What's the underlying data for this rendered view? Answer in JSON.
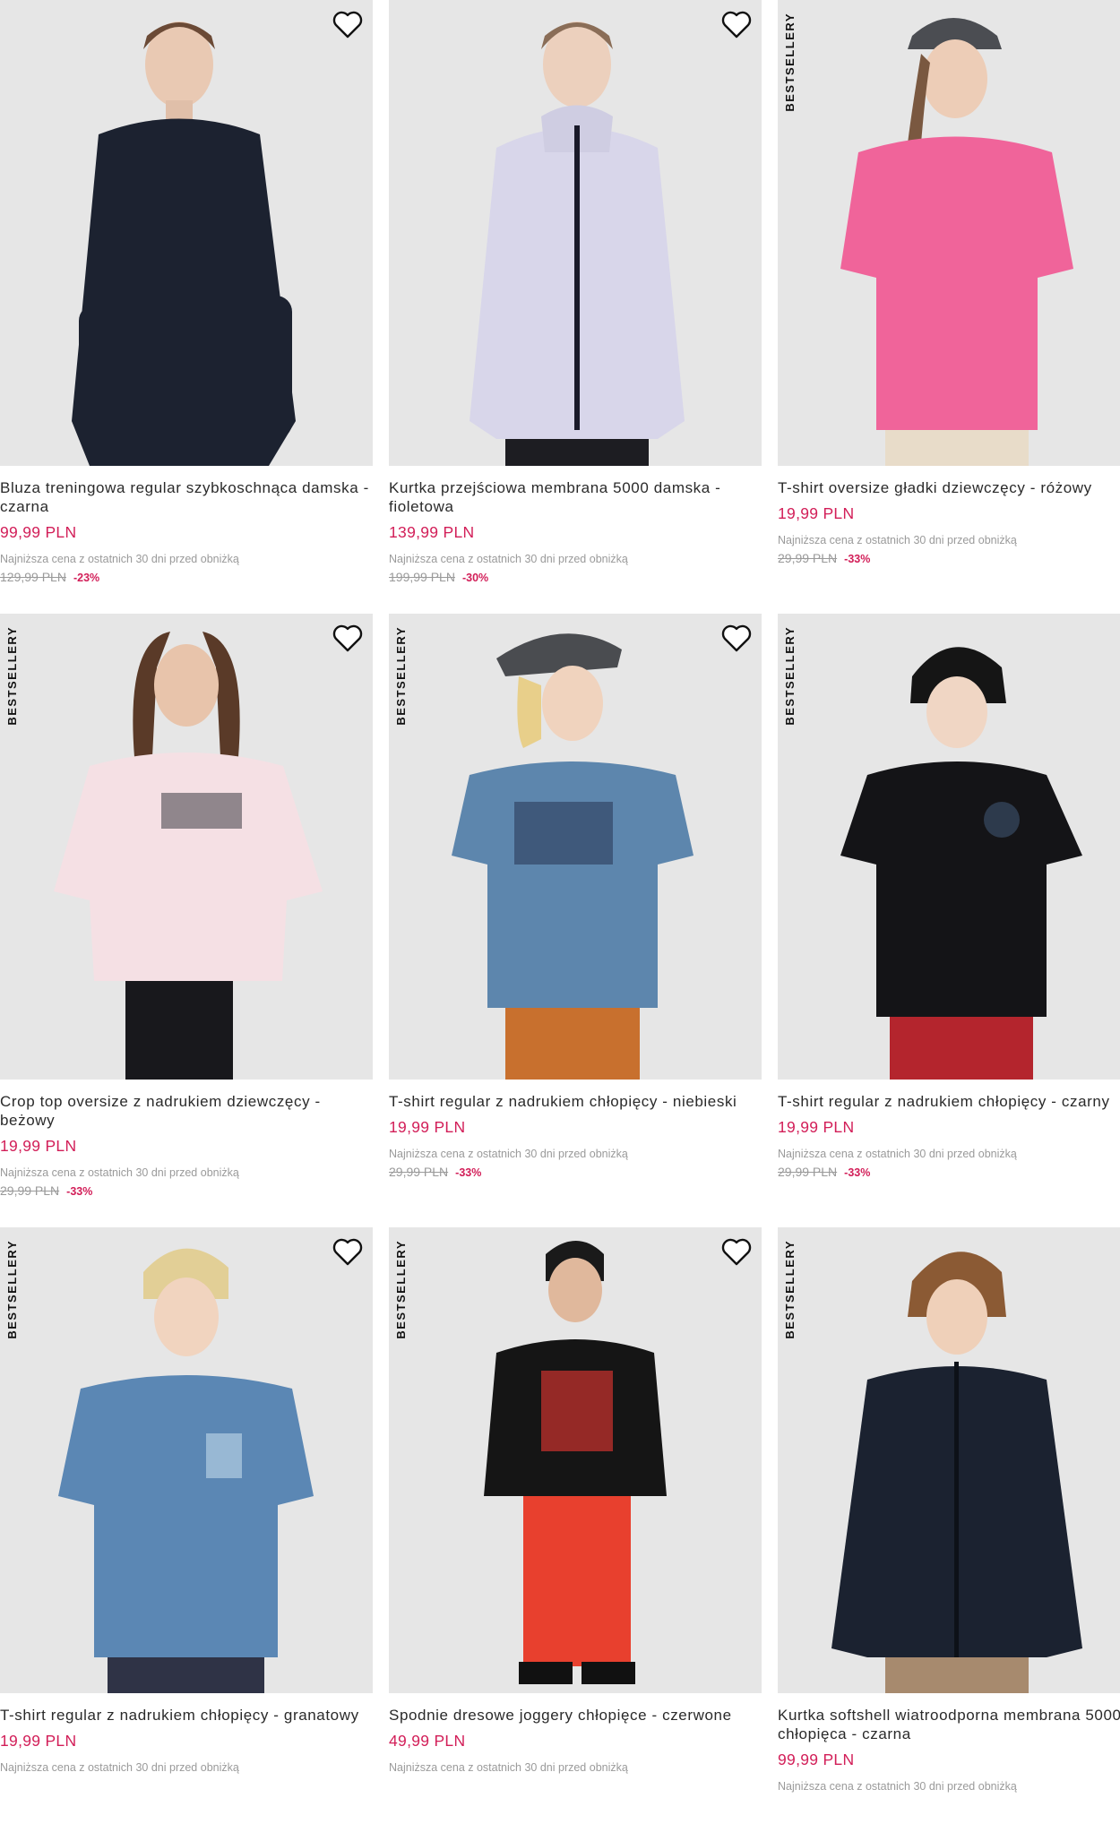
{
  "bestseller_label": "BESTSELLERY",
  "lowest_note": "Najniższa cena z ostatnich 30 dni przed obniżką",
  "products": [
    {
      "name": "Bluza treningowa regular szybkoschnąca damska - czarna",
      "price": "99,99 PLN",
      "old_price": "129,99 PLN",
      "discount": "-23%"
    },
    {
      "name": "Kurtka przejściowa membrana 5000 damska - fioletowa",
      "price": "139,99 PLN",
      "old_price": "199,99 PLN",
      "discount": "-30%"
    },
    {
      "name": "T-shirt oversize gładki dziewczęcy - różowy",
      "price": "19,99 PLN",
      "old_price": "29,99 PLN",
      "discount": "-33%"
    },
    {
      "name": "Crop top oversize z nadrukiem dziewczęcy - beżowy",
      "price": "19,99 PLN",
      "old_price": "29,99 PLN",
      "discount": "-33%"
    },
    {
      "name": "T-shirt regular z nadrukiem chłopięcy - niebieski",
      "price": "19,99 PLN",
      "old_price": "29,99 PLN",
      "discount": "-33%"
    },
    {
      "name": "T-shirt regular z nadrukiem chłopięcy - czarny",
      "price": "19,99 PLN",
      "old_price": "29,99 PLN",
      "discount": "-33%"
    },
    {
      "name": "T-shirt regular z nadrukiem chłopięcy - granatowy",
      "price": "19,99 PLN",
      "old_price": "",
      "discount": ""
    },
    {
      "name": "Spodnie dresowe joggery chłopięce - czerwone",
      "price": "49,99 PLN",
      "old_price": "",
      "discount": ""
    },
    {
      "name": "Kurtka softshell wiatroodporna membrana 5000 chłopięca - czarna",
      "price": "99,99 PLN",
      "old_price": "",
      "discount": ""
    }
  ],
  "colors": {
    "price": "#d21e58",
    "photo_bg": "#e4e4e4",
    "muted": "#9a9a9a"
  }
}
